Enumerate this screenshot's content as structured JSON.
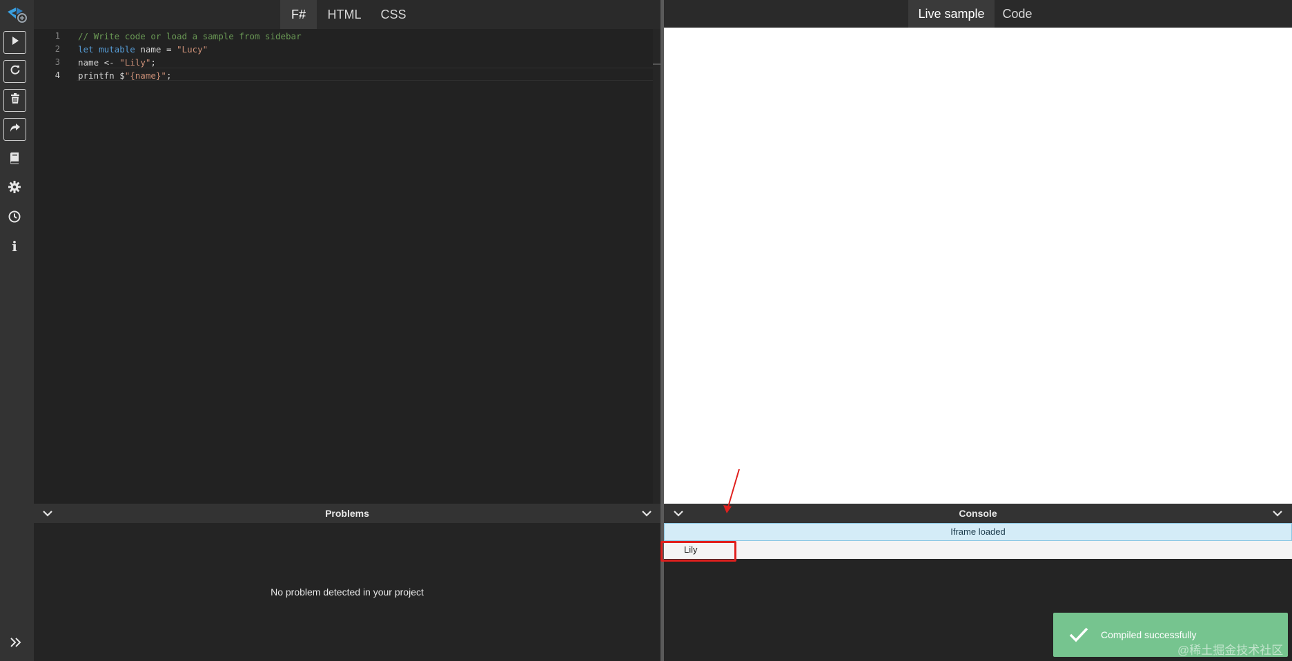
{
  "sidebar": {
    "logo": "fsharp-logo-icon",
    "buttons": [
      {
        "icon": "play-icon",
        "name": "run"
      },
      {
        "icon": "refresh-icon",
        "name": "refresh"
      },
      {
        "icon": "trash-icon",
        "name": "clear"
      },
      {
        "icon": "share-icon",
        "name": "share"
      }
    ],
    "icons": [
      "book-icon",
      "gear-icon",
      "clock-icon",
      "info-icon"
    ],
    "expand_icon": "double-chevron-right-icon",
    "info_glyph": "i"
  },
  "editor": {
    "tabs": [
      {
        "label": "F#",
        "active": true
      },
      {
        "label": "HTML",
        "active": false
      },
      {
        "label": "CSS",
        "active": false
      }
    ],
    "line_numbers": [
      "1",
      "2",
      "3",
      "4"
    ],
    "current_line": 4,
    "lines": [
      [
        {
          "t": "// Write code or load a sample from sidebar",
          "c": "com"
        }
      ],
      [
        {
          "t": "let",
          "c": "kw"
        },
        {
          "t": " ",
          "c": ""
        },
        {
          "t": "mutable",
          "c": "kw"
        },
        {
          "t": " name = ",
          "c": ""
        },
        {
          "t": "\"Lucy\"",
          "c": "str"
        }
      ],
      [
        {
          "t": "name <- ",
          "c": ""
        },
        {
          "t": "\"Lily\"",
          "c": "str"
        },
        {
          "t": ";",
          "c": ""
        }
      ],
      [
        {
          "t": "printfn $",
          "c": ""
        },
        {
          "t": "\"{name}\"",
          "c": "str"
        },
        {
          "t": ";",
          "c": ""
        }
      ]
    ]
  },
  "problems": {
    "title": "Problems",
    "message": "No problem detected in your project"
  },
  "preview": {
    "tabs": [
      {
        "label": "Live sample",
        "active": true
      },
      {
        "label": "Code",
        "active": false
      }
    ]
  },
  "console": {
    "title": "Console",
    "system_message": "Iframe loaded",
    "log": "Lily"
  },
  "toast": {
    "message": "Compiled successfully",
    "icon": "checkmark-icon"
  },
  "watermark": "@稀土掘金技术社区",
  "colors": {
    "toast_bg": "#76c48f",
    "highlight_box": "#e0201e",
    "console_info_bg": "#d4ecf7",
    "string": "#ce9178",
    "keyword": "#569cd6",
    "comment": "#6a9955"
  }
}
